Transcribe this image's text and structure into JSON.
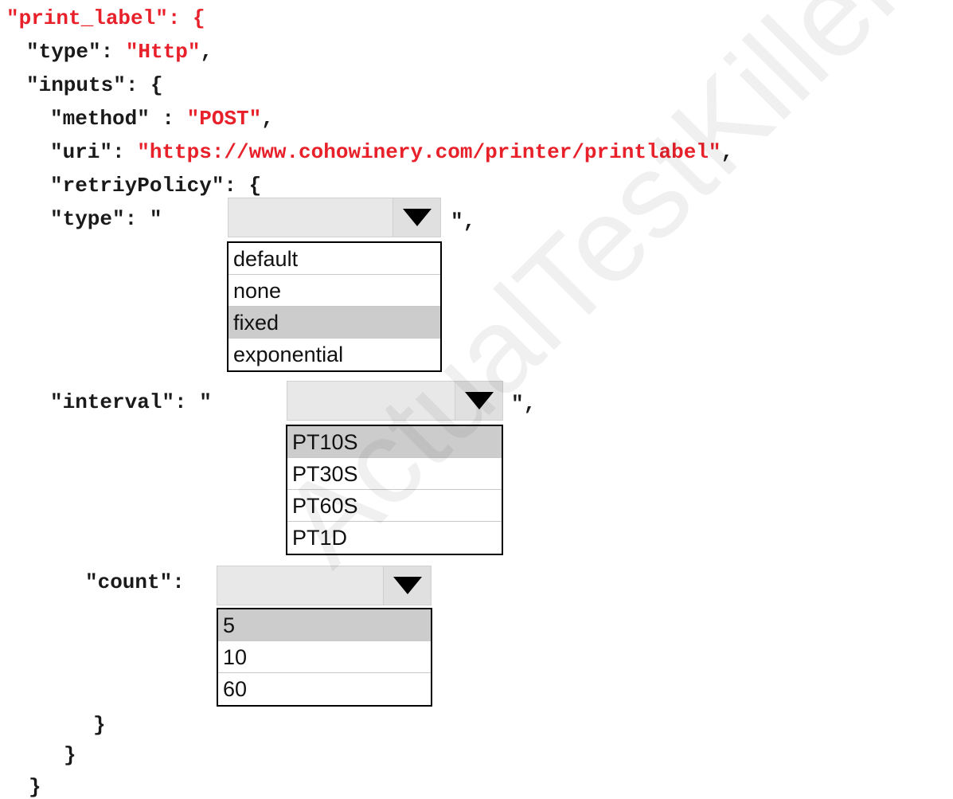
{
  "code": {
    "l1_key": "\"print_label\": {",
    "l2_key": "\"type\": ",
    "l2_val": "\"Http\"",
    "l2_tail": ",",
    "l3": "\"inputs\": {",
    "l4_key": "\"method\" : ",
    "l4_val": "\"POST\"",
    "l4_tail": ",",
    "l5_key": "\"uri\": ",
    "l5_val": "\"https://www.cohowinery.com/printer/printlabel\"",
    "l5_tail": ",",
    "l6": "\"retriyPolicy\": {",
    "type_prefix": "\"type\": \"",
    "type_suffix": "\",",
    "interval_prefix": "\"interval\": \"",
    "interval_suffix": "\",",
    "count_prefix": "\"count\":",
    "close1": "}",
    "close2": "}",
    "close3": "}"
  },
  "dropdowns": {
    "type": {
      "selected": "",
      "options": [
        "default",
        "none",
        "fixed",
        "exponential"
      ],
      "highlighted": "fixed"
    },
    "interval": {
      "selected": "",
      "options": [
        "PT10S",
        "PT30S",
        "PT60S",
        "PT1D"
      ],
      "highlighted": "PT10S"
    },
    "count": {
      "selected": "",
      "options": [
        "5",
        "10",
        "60"
      ],
      "highlighted": "5"
    }
  },
  "icons": {
    "dropdown_arrow": "triangle-down-icon"
  },
  "colors": {
    "string": "#e8202a",
    "text": "#1a1a1a",
    "highlight": "#cccccc"
  },
  "watermark": "ActualTestKillers.net"
}
